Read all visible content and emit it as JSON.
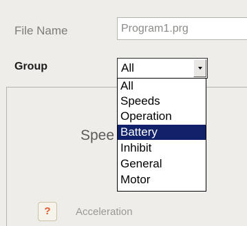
{
  "form": {
    "file_name_label": "File Name",
    "file_name_value": "Program1.prg",
    "group_label": "Group",
    "group_selected": "All"
  },
  "dropdown": {
    "options": [
      "All",
      "Speeds",
      "Operation",
      "Battery",
      "Inhibit",
      "General",
      "Motor"
    ],
    "highlighted": "Battery"
  },
  "panel": {
    "heading_partial": "Spee",
    "help_icon": "question-mark-icon",
    "help_glyph": "?",
    "acceleration_label": "Acceleration"
  },
  "colors": {
    "highlight": "#11226a",
    "background": "#efedea",
    "help_glyph": "#e0582a"
  }
}
